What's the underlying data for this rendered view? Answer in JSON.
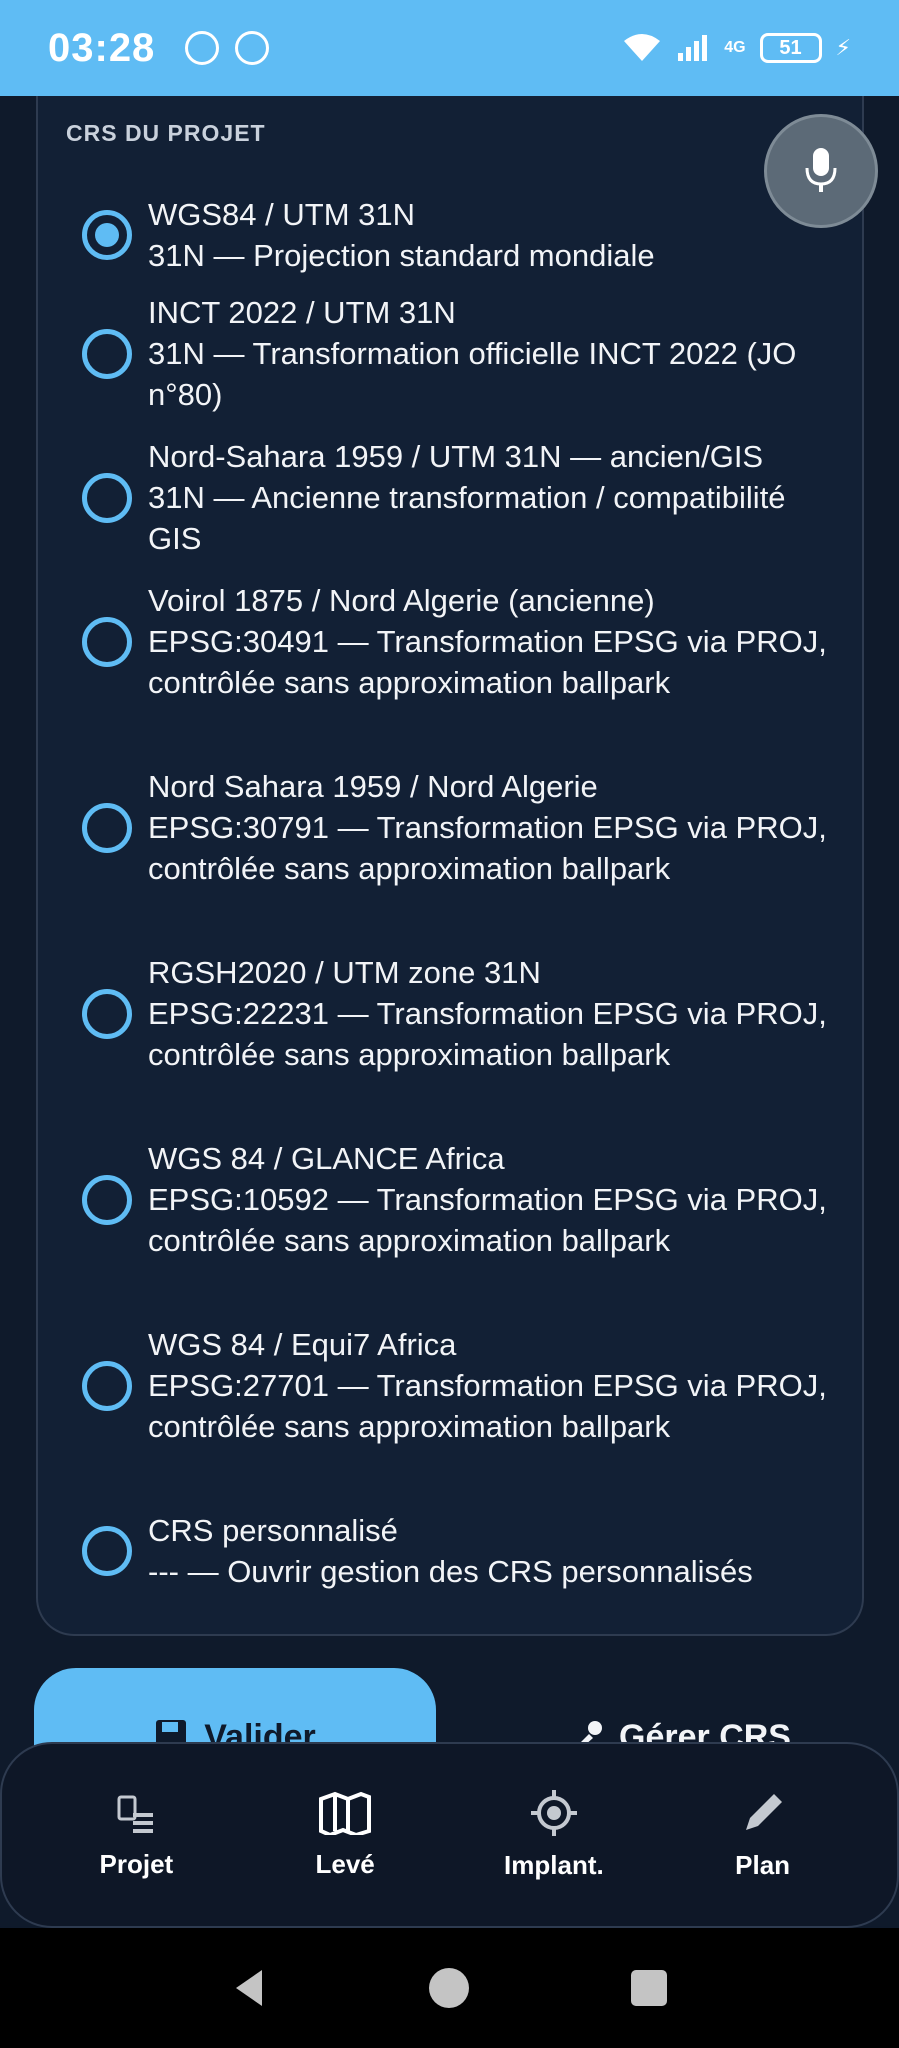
{
  "status_bar": {
    "time": "03:28",
    "network": "4G",
    "battery": "51",
    "colors": {
      "background": "#5fbcf4"
    }
  },
  "card": {
    "title": "CRS DU PROJET",
    "options": [
      {
        "name": "WGS84 / UTM 31N",
        "description": "31N — Projection standard mondiale",
        "selected": true
      },
      {
        "name": "INCT 2022 / UTM 31N",
        "description": "31N — Transformation officielle INCT 2022 (JO n°80)",
        "selected": false
      },
      {
        "name": "Nord-Sahara 1959 / UTM 31N — ancien/GIS",
        "description": "31N — Ancienne transformation / compatibilité GIS",
        "selected": false
      },
      {
        "name": "Voirol 1875 / Nord Algerie (ancienne)",
        "description": "EPSG:30491 — Transformation EPSG via PROJ, contrôlée sans approximation ballpark",
        "selected": false
      },
      {
        "name": "Nord Sahara 1959 / Nord Algerie",
        "description": "EPSG:30791 — Transformation EPSG via PROJ, contrôlée sans approximation ballpark",
        "selected": false
      },
      {
        "name": "RGSH2020 / UTM zone 31N",
        "description": "EPSG:22231 — Transformation EPSG via PROJ, contrôlée sans approximation ballpark",
        "selected": false
      },
      {
        "name": "WGS 84 / GLANCE Africa",
        "description": "EPSG:10592 — Transformation EPSG via PROJ, contrôlée sans approximation ballpark",
        "selected": false
      },
      {
        "name": "WGS 84 / Equi7 Africa",
        "description": "EPSG:27701 — Transformation EPSG via PROJ, contrôlée sans approximation ballpark",
        "selected": false
      },
      {
        "name": "CRS personnalisé",
        "description": "--- — Ouvrir gestion des CRS personnalisés",
        "selected": false
      }
    ]
  },
  "actions": {
    "validate_label": "Valider",
    "manage_label": "Gérer CRS"
  },
  "bottom_nav": {
    "items": [
      {
        "label": "Projet",
        "icon": "project-icon"
      },
      {
        "label": "Levé",
        "icon": "map-icon"
      },
      {
        "label": "Implant.",
        "icon": "target-icon"
      },
      {
        "label": "Plan",
        "icon": "pencil-icon"
      }
    ]
  },
  "theme": {
    "accent": "#5fbcf4",
    "background": "#0f1a2b",
    "card": "#122035"
  }
}
